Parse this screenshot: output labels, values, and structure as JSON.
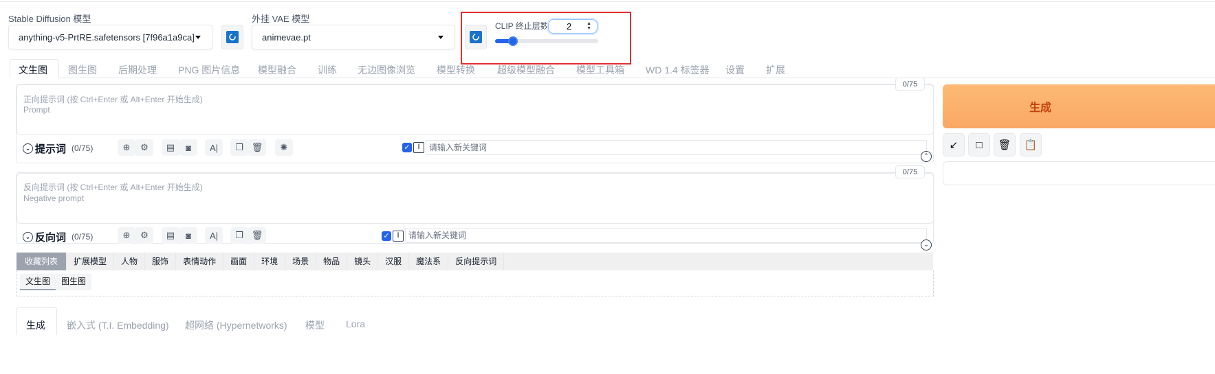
{
  "sd_model": {
    "label": "Stable Diffusion 模型",
    "value": "anything-v5-PrtRE.safetensors [7f96a1a9ca]"
  },
  "vae_model": {
    "label": "外挂 VAE 模型",
    "value": "animevae.pt"
  },
  "clip": {
    "label": "CLIP 终止层数",
    "value": "2",
    "slider_fraction": 0.1
  },
  "tabs": [
    "文生图",
    "图生图",
    "后期处理",
    "PNG 图片信息",
    "模型融合",
    "训练",
    "无边图像浏览",
    "模型转换",
    "超级模型融合",
    "模型工具箱",
    "WD 1.4 标签器",
    "设置",
    "扩展"
  ],
  "prompt": {
    "placeholder_cn": "正向提示词 (按 Ctrl+Enter 或 Alt+Enter 开始生成)",
    "placeholder_en": "Prompt",
    "counter": "0/75",
    "section_title": "提示词",
    "section_count": "(0/75)",
    "keyword_placeholder": "请输入新关键词"
  },
  "negative": {
    "placeholder_cn": "反向提示词 (按 Ctrl+Enter 或 Alt+Enter 开始生成)",
    "placeholder_en": "Negative prompt",
    "counter": "0/75",
    "section_title": "反向词",
    "section_count": "(0/75)",
    "keyword_placeholder": "请输入新关键词"
  },
  "category_tabs": [
    "收藏列表",
    "扩展模型",
    "人物",
    "服饰",
    "表情动作",
    "画面",
    "环境",
    "场景",
    "物品",
    "镜头",
    "汉服",
    "魔法系",
    "反向提示词"
  ],
  "sub_tabs": [
    "文生图",
    "图生图"
  ],
  "generate": {
    "label": "生成"
  },
  "bottom_tabs": [
    "生成",
    "嵌入式 (T.I. Embedding)",
    "超网络 (Hypernetworks)",
    "模型",
    "Lora"
  ],
  "colors": {
    "accent": "#2563eb",
    "generate_bg": "#fdba74",
    "generate_text": "#c2410c",
    "highlight_box": "#e03030"
  }
}
